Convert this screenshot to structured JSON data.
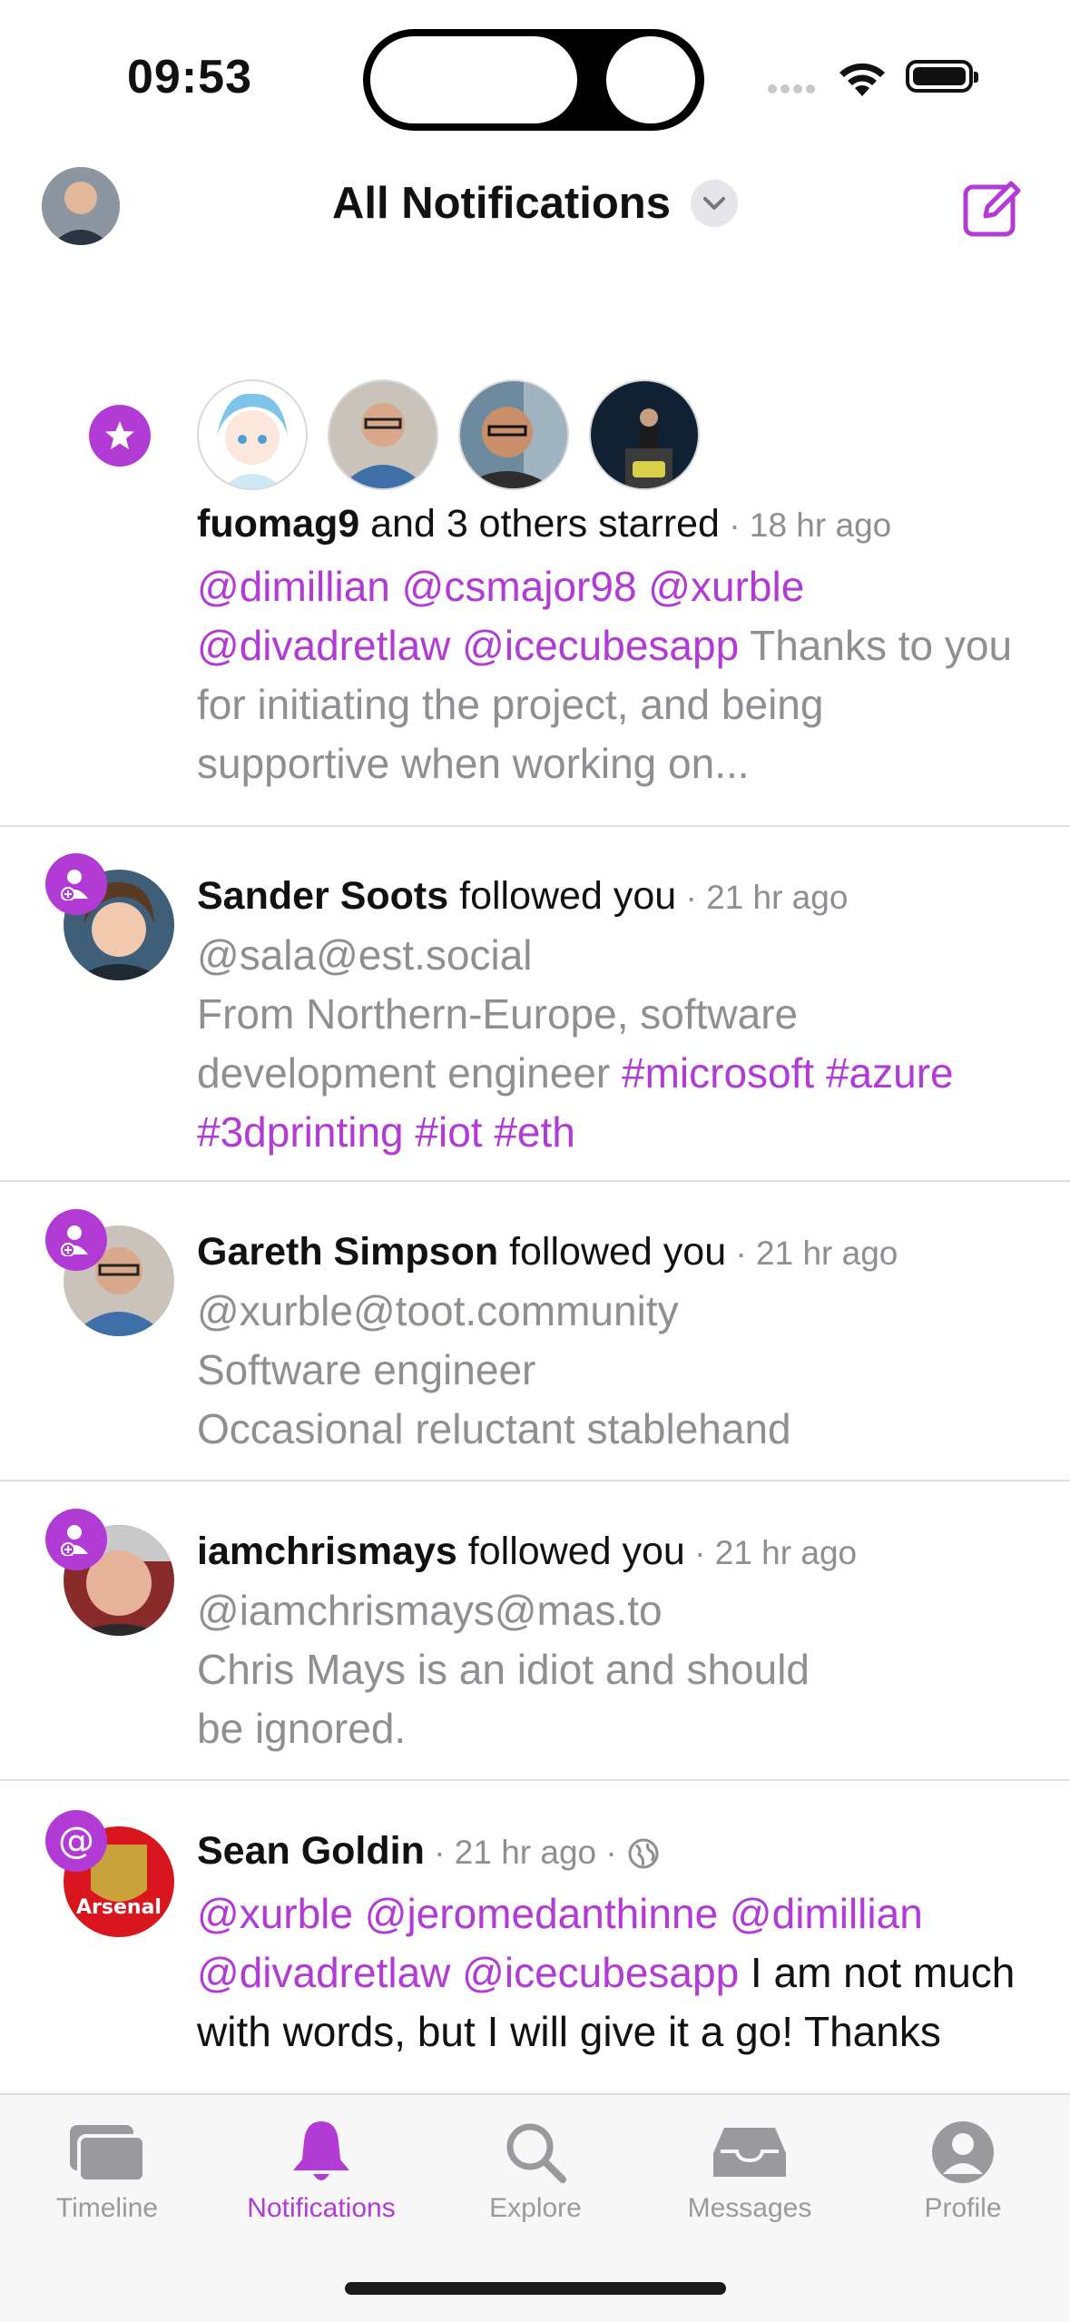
{
  "status_bar": {
    "time": "09:53"
  },
  "nav": {
    "title": "All Notifications"
  },
  "colors": {
    "accent": "#b23bd6",
    "muted": "#8e8e93"
  },
  "notifications": [
    {
      "type": "favourite",
      "badge_icon": "star-icon",
      "actor": "fuomag9",
      "action": " and 3 others starred",
      "time": "18 hr ago",
      "mentions": "@dimillian @csmajor98 @xurble @divadretlaw @icecubesapp",
      "text": " Thanks to you for initiating the project, and being supportive when working on..."
    },
    {
      "type": "follow",
      "badge_icon": "person-add-icon",
      "actor": "Sander Soots",
      "action": " followed you",
      "time": "21 hr ago",
      "handle": "@sala@est.social",
      "bio": "From Northern-Europe, software development engineer ",
      "tags": "#microsoft #azure #3dprinting #iot #eth"
    },
    {
      "type": "follow",
      "badge_icon": "person-add-icon",
      "actor": "Gareth Simpson",
      "action": " followed you",
      "time": "21 hr ago",
      "handle": "@xurble@toot.community",
      "bio_line1": "Software engineer",
      "bio_line2": "Occasional reluctant stablehand"
    },
    {
      "type": "follow",
      "badge_icon": "person-add-icon",
      "actor": "iamchrismays",
      "action": " followed you",
      "time": "21 hr ago",
      "handle": "@iamchrismays@mas.to",
      "bio_line1": "Chris Mays is an idiot and should",
      "bio_line2": "be ignored."
    },
    {
      "type": "mention",
      "badge_icon": "at-icon",
      "actor": "Sean Goldin",
      "time": "21 hr ago",
      "mentions": "@xurble @jeromedanthinne @dimillian @divadretlaw @icecubesapp",
      "text": " I am not much with words, but I will give it a go! Thanks",
      "avatar_text": "Arsenal"
    }
  ],
  "tabs": [
    {
      "label": "Timeline",
      "icon": "timeline-icon",
      "active": false
    },
    {
      "label": "Notifications",
      "icon": "bell-icon",
      "active": true
    },
    {
      "label": "Explore",
      "icon": "search-icon",
      "active": false
    },
    {
      "label": "Messages",
      "icon": "tray-icon",
      "active": false
    },
    {
      "label": "Profile",
      "icon": "profile-icon",
      "active": false
    }
  ]
}
